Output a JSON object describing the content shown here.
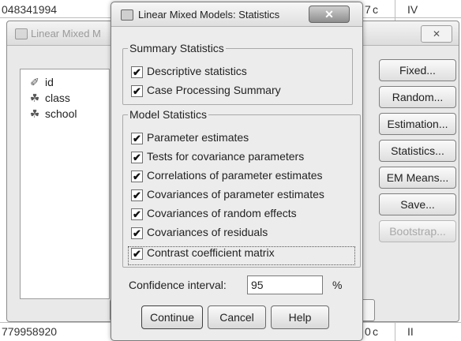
{
  "spreadsheet": {
    "top_left_value": "048341994",
    "top_mid_value": "7",
    "top_mid_letter": "c",
    "top_right_value": "IV",
    "bottom_left_value": "779958920",
    "bottom_mid_value": "0",
    "bottom_mid_letter": "c",
    "bottom_right_value": "II"
  },
  "back_dialog": {
    "title": "Linear Mixed M",
    "close_label": "✕",
    "variables": [
      {
        "icon": "ruler-icon",
        "glyph": "✐",
        "label": "id"
      },
      {
        "icon": "nominal-icon",
        "glyph": "☘",
        "label": "class"
      },
      {
        "icon": "nominal-icon",
        "glyph": "☘",
        "label": "school"
      }
    ],
    "buttons": [
      {
        "label": "Fixed...",
        "disabled": false
      },
      {
        "label": "Random...",
        "disabled": false
      },
      {
        "label": "Estimation...",
        "disabled": false
      },
      {
        "label": "Statistics...",
        "disabled": false
      },
      {
        "label": "EM Means...",
        "disabled": false
      },
      {
        "label": "Save...",
        "disabled": false
      },
      {
        "label": "Bootstrap...",
        "disabled": true
      }
    ]
  },
  "statistics_dialog": {
    "title": "Linear Mixed Models: Statistics",
    "close_label": "✕",
    "summary_group": {
      "legend": "Summary Statistics",
      "items": [
        {
          "label": "Descriptive statistics",
          "checked": true
        },
        {
          "label": "Case Processing Summary",
          "checked": true
        }
      ]
    },
    "model_group": {
      "legend": "Model Statistics",
      "items": [
        {
          "label": "Parameter estimates",
          "checked": true
        },
        {
          "label": "Tests for covariance parameters",
          "checked": true
        },
        {
          "label": "Correlations of parameter estimates",
          "checked": true
        },
        {
          "label": "Covariances of parameter estimates",
          "checked": true
        },
        {
          "label": "Covariances of random effects",
          "checked": true
        },
        {
          "label": "Covariances of residuals",
          "checked": true
        },
        {
          "label": "Contrast coefficient matrix",
          "checked": true
        }
      ]
    },
    "confidence": {
      "label": "Confidence interval:",
      "value": "95",
      "unit": "%"
    },
    "buttons": {
      "continue": "Continue",
      "cancel": "Cancel",
      "help": "Help"
    }
  }
}
